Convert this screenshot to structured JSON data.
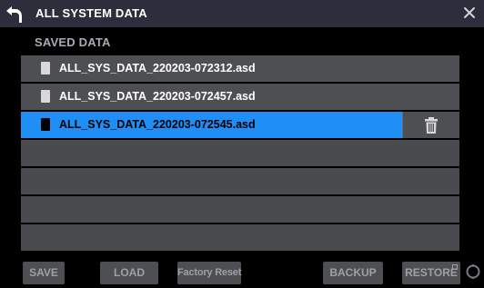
{
  "window": {
    "title": "ALL SYSTEM DATA",
    "back_icon": "back-arrow-icon",
    "close_icon": "close-icon"
  },
  "list": {
    "section_label": "SAVED DATA",
    "files": [
      {
        "name": "ALL_SYS_DATA_220203-072312.asd",
        "selected": false
      },
      {
        "name": "ALL_SYS_DATA_220203-072457.asd",
        "selected": false
      },
      {
        "name": "ALL_SYS_DATA_220203-072545.asd",
        "selected": true
      }
    ],
    "empty_rows": 4,
    "delete_icon": "trash-icon"
  },
  "buttons": {
    "save": "SAVE",
    "load": "LOAD",
    "factory_reset": "Factory Reset",
    "backup": "BACKUP",
    "restore": "RESTORE"
  },
  "colors": {
    "titlebar": "#2c2f3b",
    "selected_row": "#1f8ff5",
    "row": "#4e4f52",
    "button_text": "#9ea0a6"
  }
}
